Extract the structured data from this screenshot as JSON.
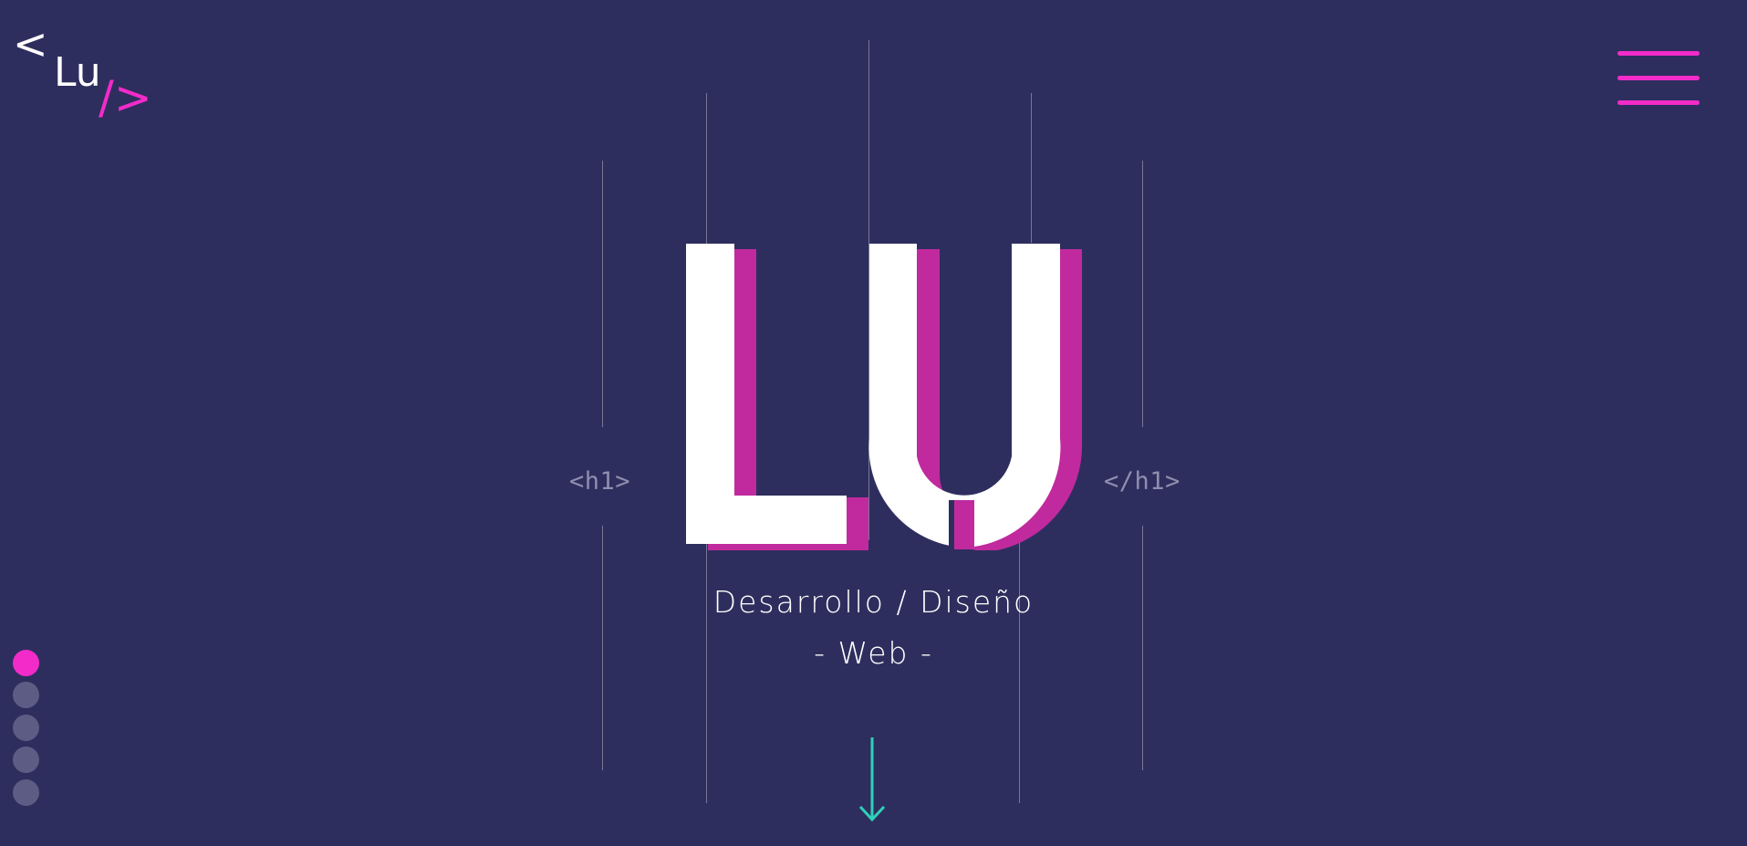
{
  "logo": {
    "text_open": "<",
    "text_name": "Lu",
    "text_close": "/>"
  },
  "hero": {
    "title": "LU",
    "tag_open": "<h1>",
    "tag_close": "</h1>",
    "subtitle_line1": "Desarrollo / Diseño",
    "subtitle_line2": "- Web -"
  },
  "colors": {
    "background": "#2e2e5e",
    "accent": "#f22bc9",
    "shadow": "#c02a9e",
    "arrow": "#2fcfb8",
    "dot_inactive": "#5c5c85"
  },
  "icons": {
    "menu": "hamburger-icon",
    "scroll": "arrow-down-icon"
  },
  "pagination": {
    "total": 5,
    "active_index": 0
  }
}
